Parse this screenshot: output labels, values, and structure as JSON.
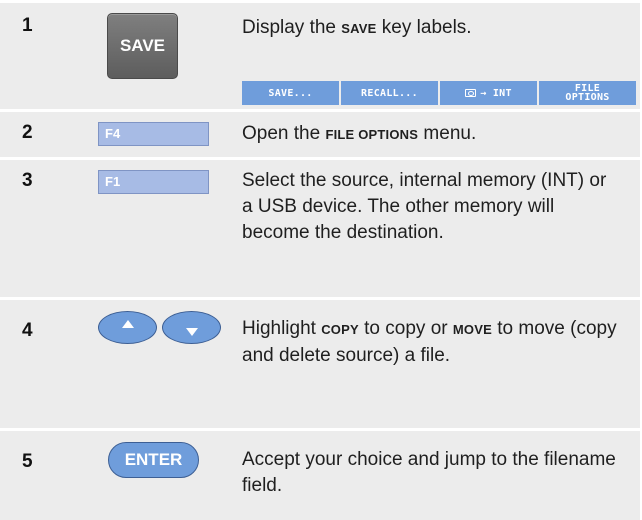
{
  "steps": [
    {
      "number": "1",
      "key": "SAVE",
      "text_before": "Display the ",
      "text_bold": "SAVE",
      "text_after": " key labels.",
      "softkeys": [
        "SAVE...",
        "RECALL...",
        "→ INT",
        "FILE\nOPTIONS"
      ]
    },
    {
      "number": "2",
      "key": "F4",
      "text_before": "Open the ",
      "text_bold": "FILE OPTIONS",
      "text_after": " menu."
    },
    {
      "number": "3",
      "key": "F1",
      "text": "Select the source, internal memory (INT) or a USB device.  The other memory will become the destination."
    },
    {
      "number": "4",
      "keys": [
        "arrow-up",
        "arrow-down"
      ],
      "text_1": "Highlight ",
      "bold_1": "COPY",
      "text_2": " to copy or ",
      "bold_2": "MOVE",
      "text_3": " to move (copy and delete source) a file."
    },
    {
      "number": "5",
      "key": "ENTER",
      "text": "Accept your choice and jump to the filename field."
    }
  ],
  "colors": {
    "row_bg": "#ececec",
    "softkey_bg": "#6f9ddb",
    "fkey_bg": "#a7bbe5",
    "save_key_bg": "#6b6b6b"
  }
}
